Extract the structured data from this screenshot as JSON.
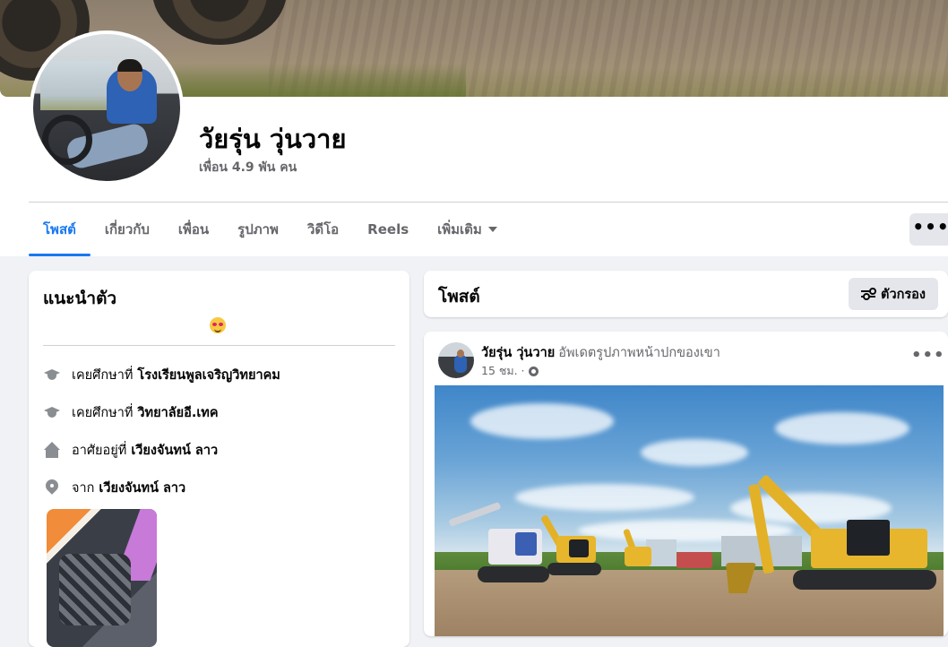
{
  "profile": {
    "name": "วัยรุ่น วุ่นวาย",
    "friends": "เพื่อน 4.9 พัน คน"
  },
  "tabs": [
    {
      "label": "โพสต์",
      "active": true
    },
    {
      "label": "เกี่ยวกับ"
    },
    {
      "label": "เพื่อน"
    },
    {
      "label": "รูปภาพ"
    },
    {
      "label": "วิดีโอ"
    },
    {
      "label": "Reels"
    },
    {
      "label": "เพิ่มเติม"
    }
  ],
  "more_button": "•••",
  "intro": {
    "title": "แนะนำตัว",
    "items": [
      {
        "icon": "graduation-cap-icon",
        "prefix": "เคยศึกษาที่",
        "value": "โรงเรียนพูลเจริญวิทยาคม"
      },
      {
        "icon": "graduation-cap-icon",
        "prefix": "เคยศึกษาที่",
        "value": "วิทยาลัยอี.เทค"
      },
      {
        "icon": "home-icon",
        "prefix": "อาศัยอยู่ที่",
        "value": "เวียงจันทน์ ลาว"
      },
      {
        "icon": "location-pin-icon",
        "prefix": "จาก",
        "value": "เวียงจันทน์ ลาว"
      }
    ]
  },
  "posts": {
    "title": "โพสต์",
    "filter_label": "ตัวกรอง"
  },
  "post": {
    "author": "วัยรุ่น วุ่นวาย",
    "action": "อัพเดตรูปภาพหน้าปกของเขา",
    "time": "15 ชม. ·",
    "more": "•••"
  },
  "colors": {
    "accent": "#1877f2",
    "background": "#f0f2f5",
    "secondary_text": "#65676b"
  }
}
